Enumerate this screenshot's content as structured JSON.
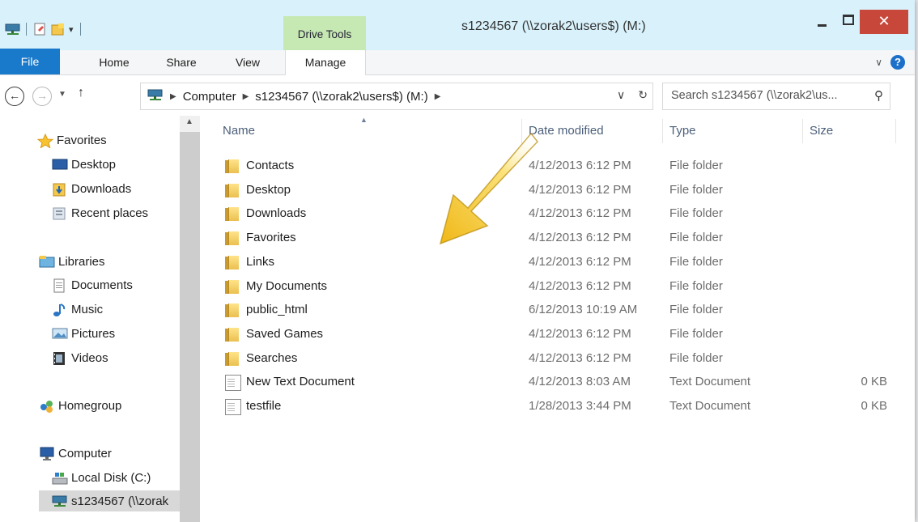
{
  "window": {
    "title": "s1234567 (\\\\zorak2\\users$) (M:)",
    "context_tab_group": "Drive Tools",
    "close_glyph": "✕"
  },
  "ribbon": {
    "tabs": [
      {
        "label": "File"
      },
      {
        "label": "Home"
      },
      {
        "label": "Share"
      },
      {
        "label": "View"
      },
      {
        "label": "Manage"
      }
    ],
    "help_glyph": "?"
  },
  "address": {
    "crumbs": [
      "Computer",
      "s1234567 (\\\\zorak2\\users$) (M:)"
    ],
    "search_placeholder": "Search s1234567 (\\\\zorak2\\us..."
  },
  "nav": {
    "favorites_label": "Favorites",
    "favorites": [
      {
        "label": "Desktop",
        "icon": "desktop-icon"
      },
      {
        "label": "Downloads",
        "icon": "downloads-folder-icon"
      },
      {
        "label": "Recent places",
        "icon": "recent-places-icon"
      }
    ],
    "libraries_label": "Libraries",
    "libraries": [
      {
        "label": "Documents",
        "icon": "documents-icon"
      },
      {
        "label": "Music",
        "icon": "music-icon"
      },
      {
        "label": "Pictures",
        "icon": "pictures-icon"
      },
      {
        "label": "Videos",
        "icon": "videos-icon"
      }
    ],
    "homegroup_label": "Homegroup",
    "computer_label": "Computer",
    "computer_items": [
      {
        "label": "Local Disk (C:)",
        "icon": "local-disk-icon"
      },
      {
        "label": "s1234567 (\\\\zorak",
        "icon": "network-drive-icon",
        "selected": true
      }
    ]
  },
  "list": {
    "columns": {
      "name": "Name",
      "date": "Date modified",
      "type": "Type",
      "size": "Size"
    },
    "rows": [
      {
        "name": "Contacts",
        "date": "4/12/2013 6:12 PM",
        "type": "File folder",
        "size": "",
        "kind": "folder"
      },
      {
        "name": "Desktop",
        "date": "4/12/2013 6:12 PM",
        "type": "File folder",
        "size": "",
        "kind": "folder"
      },
      {
        "name": "Downloads",
        "date": "4/12/2013 6:12 PM",
        "type": "File folder",
        "size": "",
        "kind": "folder"
      },
      {
        "name": "Favorites",
        "date": "4/12/2013 6:12 PM",
        "type": "File folder",
        "size": "",
        "kind": "folder"
      },
      {
        "name": "Links",
        "date": "4/12/2013 6:12 PM",
        "type": "File folder",
        "size": "",
        "kind": "folder"
      },
      {
        "name": "My Documents",
        "date": "4/12/2013 6:12 PM",
        "type": "File folder",
        "size": "",
        "kind": "folder"
      },
      {
        "name": "public_html",
        "date": "6/12/2013 10:19 AM",
        "type": "File folder",
        "size": "",
        "kind": "folder"
      },
      {
        "name": "Saved Games",
        "date": "4/12/2013 6:12 PM",
        "type": "File folder",
        "size": "",
        "kind": "folder"
      },
      {
        "name": "Searches",
        "date": "4/12/2013 6:12 PM",
        "type": "File folder",
        "size": "",
        "kind": "folder"
      },
      {
        "name": "New Text Document",
        "date": "4/12/2013 8:03 AM",
        "type": "Text Document",
        "size": "0 KB",
        "kind": "doc"
      },
      {
        "name": "testfile",
        "date": "1/28/2013 3:44 PM",
        "type": "Text Document",
        "size": "0 KB",
        "kind": "doc"
      }
    ]
  },
  "colors": {
    "file_tab": "#1979ca",
    "close_button": "#c7473a",
    "context_tab": "#c6e8b2",
    "arrow_yellow": "#f4c21a"
  }
}
